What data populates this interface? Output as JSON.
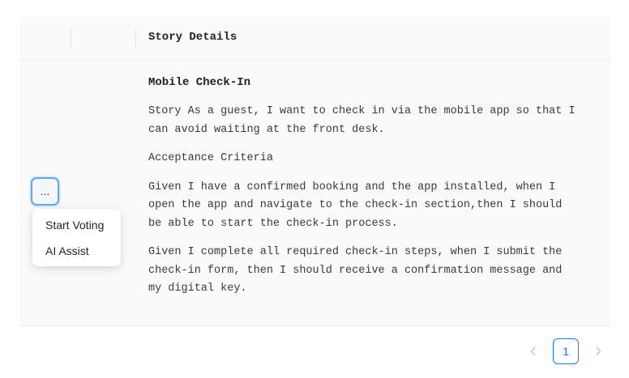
{
  "table": {
    "header_title": "Story Details"
  },
  "story": {
    "title": "Mobile Check-In",
    "description_lines": [
      "Story As a guest, I want to check in via the mobile app so that I",
      "can avoid waiting at the front desk."
    ],
    "criteria_heading": "Acceptance Criteria",
    "criteria_1_lines": [
      "Given I have a confirmed booking and the app installed, when I",
      "open the app and navigate to the check-in section,then I should",
      "be able to start the check-in process."
    ],
    "criteria_2_lines": [
      "Given I complete all required check-in steps, when I submit the",
      "check-in form, then I should receive a confirmation message and",
      "my digital key."
    ]
  },
  "actions": {
    "more_label": "...",
    "menu_items": [
      "Start Voting",
      "AI Assist"
    ]
  },
  "pagination": {
    "current_page": "1",
    "prev_icon": "chevron-left-icon",
    "next_icon": "chevron-right-icon",
    "accent_color": "#1677ff"
  }
}
